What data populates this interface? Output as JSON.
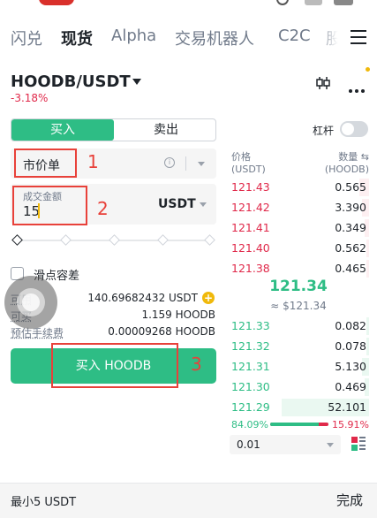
{
  "nav": {
    "tabs": [
      "闪兑",
      "现货",
      "Alpha",
      "交易机器人",
      "C2C",
      "股"
    ],
    "active": "现货"
  },
  "pair": {
    "symbol": "HOODB/USDT",
    "change": "-3.18%"
  },
  "trade_side": {
    "buy_label": "买入",
    "sell_label": "卖出",
    "selected": "买入"
  },
  "leverage": {
    "label": "杠杆",
    "enabled": false
  },
  "order_form": {
    "order_type": "市价单",
    "amount_caption": "成交金额",
    "amount_value": "15",
    "amount_unit": "USDT",
    "slider_level_percent": 0,
    "slippage_label": "滑点容差",
    "available_label": "可用",
    "available_value": "140.69682432 USDT",
    "buyable_label": "可买",
    "buyable_value": "1.159 HOODB",
    "fee_label": "预估手续费",
    "fee_value": "0.00009268 HOODB",
    "submit_label": "买入 HOODB"
  },
  "annotations": [
    "1",
    "2",
    "3"
  ],
  "order_book": {
    "price_header": "价格",
    "price_unit": "(USDT)",
    "qty_header": "数量",
    "qty_unit": "(HOODB)",
    "asks": [
      {
        "price": "121.43",
        "qty": "0.565",
        "depth": 0.07
      },
      {
        "price": "121.42",
        "qty": "3.390",
        "depth": 0.05
      },
      {
        "price": "121.41",
        "qty": "0.349",
        "depth": 0.03
      },
      {
        "price": "121.40",
        "qty": "0.562",
        "depth": 0.02
      },
      {
        "price": "121.38",
        "qty": "0.465",
        "depth": 0.02
      }
    ],
    "mid_price": "121.34",
    "mid_fiat": "≈ $121.34",
    "bids": [
      {
        "price": "121.33",
        "qty": "0.082",
        "depth": 0.02
      },
      {
        "price": "121.32",
        "qty": "0.078",
        "depth": 0.02
      },
      {
        "price": "121.31",
        "qty": "5.130",
        "depth": 0.05
      },
      {
        "price": "121.30",
        "qty": "0.469",
        "depth": 0.03
      },
      {
        "price": "121.29",
        "qty": "52.101",
        "depth": 0.62
      }
    ],
    "buy_ratio": "84.09%",
    "sell_ratio": "15.91%",
    "buy_ratio_value": 84.09,
    "precision": "0.01"
  },
  "bottom_bar": {
    "hint": "最小5 USDT",
    "done_label": "完成"
  },
  "colors": {
    "buy_green": "#2ebd85",
    "sell_red": "#e0294a",
    "accent_yellow": "#f0b90b",
    "annotation_red": "#e8413a"
  }
}
